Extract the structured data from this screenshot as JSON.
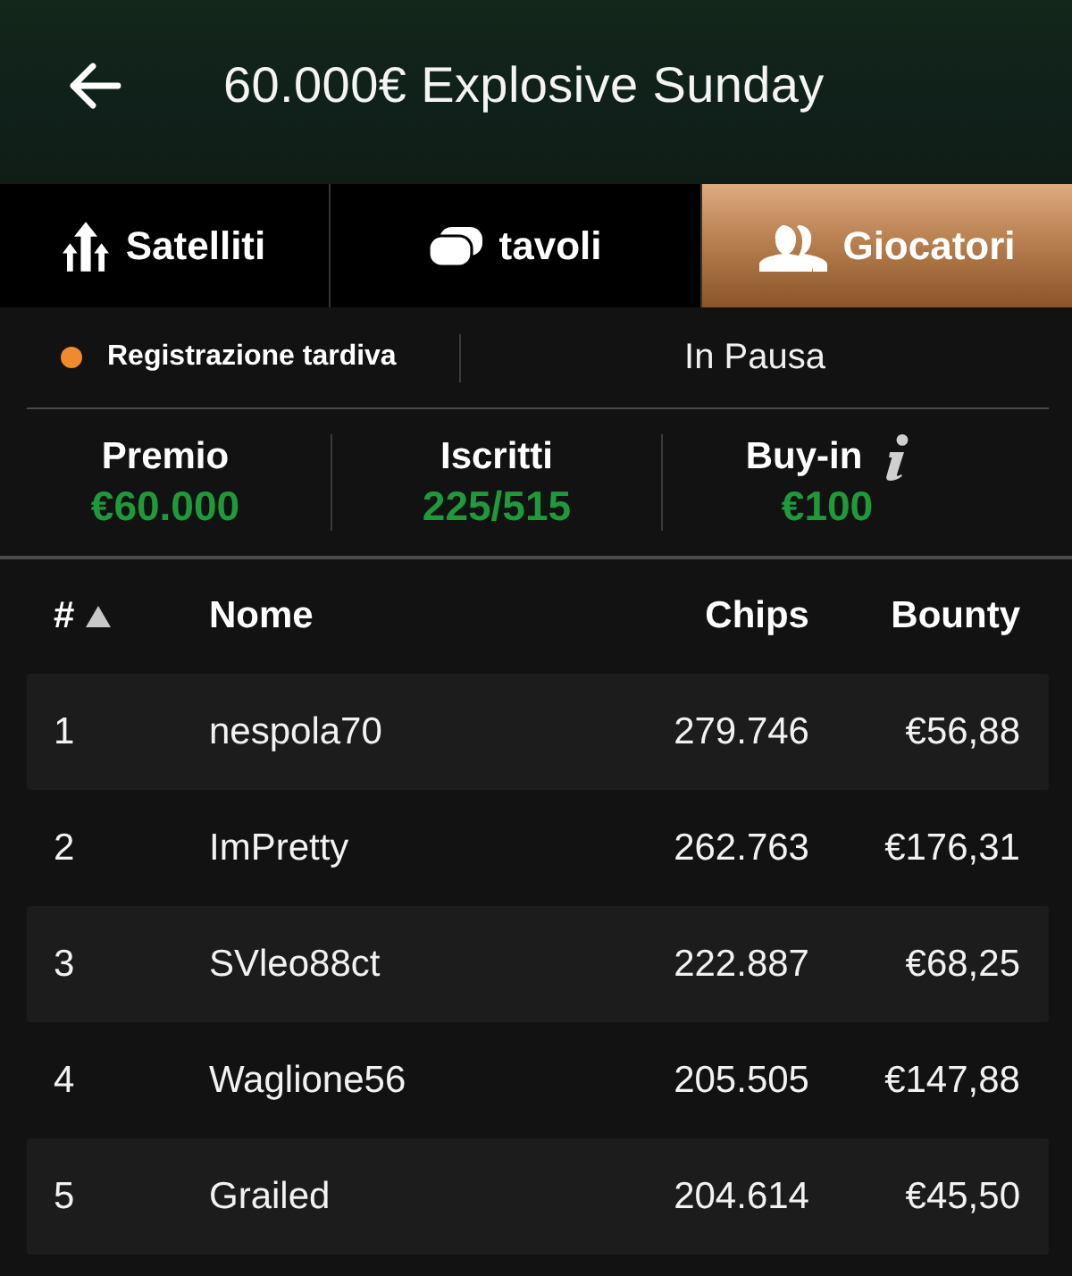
{
  "header": {
    "title": "60.000€ Explosive Sunday"
  },
  "tabs": [
    {
      "label": "Satelliti",
      "selected": false
    },
    {
      "label": "tavoli",
      "selected": false
    },
    {
      "label": "Giocatori",
      "selected": true
    }
  ],
  "status": {
    "registration": "Registrazione tardiva",
    "state": "In Pausa"
  },
  "stats": [
    {
      "label": "Premio",
      "value": "€60.000",
      "info": false
    },
    {
      "label": "Iscritti",
      "value": "225/515",
      "info": false
    },
    {
      "label": "Buy-in",
      "value": "€100",
      "info": true
    }
  ],
  "table": {
    "columns": [
      {
        "label": "#",
        "sorted": true
      },
      {
        "label": "Nome",
        "sorted": false
      },
      {
        "label": "Chips",
        "sorted": false
      },
      {
        "label": "Bounty",
        "sorted": false
      }
    ],
    "rows": [
      {
        "rank": "1",
        "name": "nespola70",
        "chips": "279.746",
        "bounty": "€56,88"
      },
      {
        "rank": "2",
        "name": "ImPretty",
        "chips": "262.763",
        "bounty": "€176,31"
      },
      {
        "rank": "3",
        "name": "SVleo88ct",
        "chips": "222.887",
        "bounty": "€68,25"
      },
      {
        "rank": "4",
        "name": "Waglione56",
        "chips": "205.505",
        "bounty": "€147,88"
      },
      {
        "rank": "5",
        "name": "Grailed",
        "chips": "204.614",
        "bounty": "€45,50"
      }
    ]
  }
}
